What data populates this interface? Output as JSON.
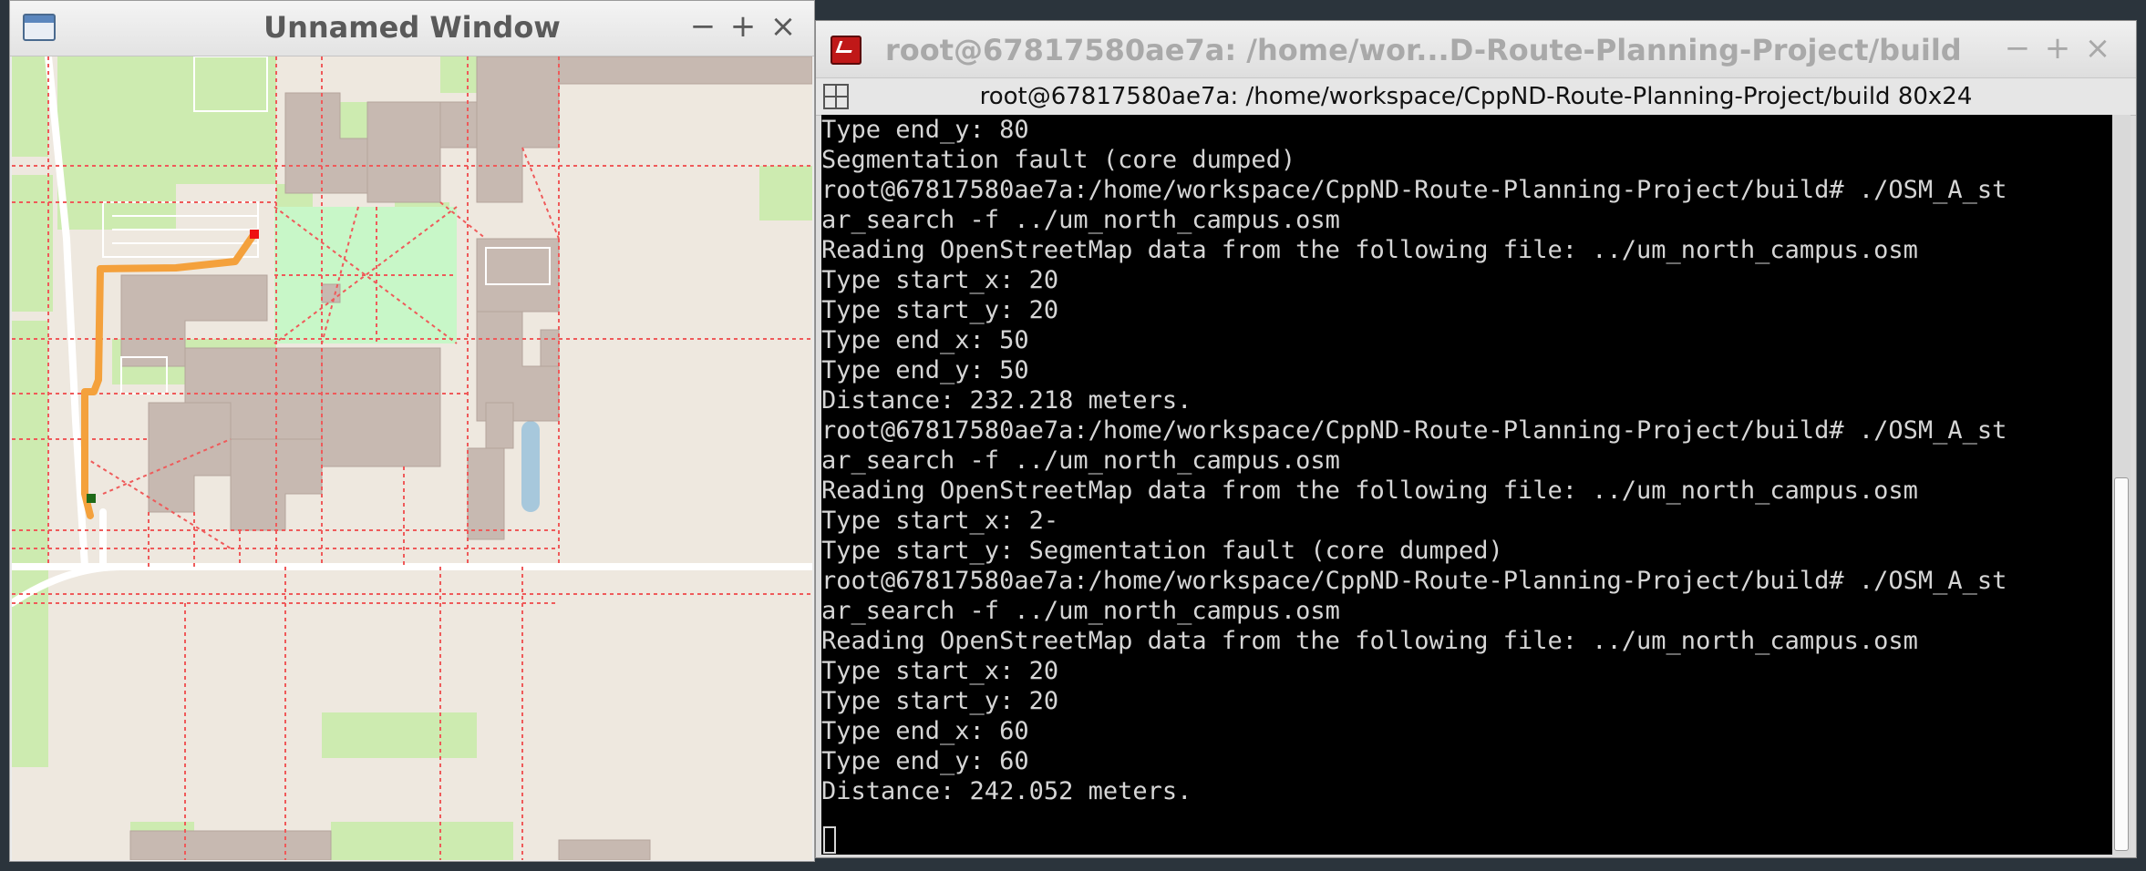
{
  "map_window": {
    "title": "Unnamed Window",
    "controls": {
      "minimize": "−",
      "maximize": "+",
      "close": "×"
    }
  },
  "terminal_window": {
    "title": "root@67817580ae7a: /home/wor...D-Route-Planning-Project/build",
    "subtitle": "root@67817580ae7a: /home/workspace/CppND-Route-Planning-Project/build 80x24",
    "controls": {
      "minimize": "−",
      "maximize": "+",
      "close": "×"
    },
    "lines": [
      "Type end_y: 80",
      "Segmentation fault (core dumped)",
      "root@67817580ae7a:/home/workspace/CppND-Route-Planning-Project/build# ./OSM_A_st",
      "ar_search -f ../um_north_campus.osm",
      "Reading OpenStreetMap data from the following file: ../um_north_campus.osm",
      "Type start_x: 20",
      "Type start_y: 20",
      "Type end_x: 50",
      "Type end_y: 50",
      "Distance: 232.218 meters.",
      "root@67817580ae7a:/home/workspace/CppND-Route-Planning-Project/build# ./OSM_A_st",
      "ar_search -f ../um_north_campus.osm",
      "Reading OpenStreetMap data from the following file: ../um_north_campus.osm",
      "Type start_x: 2-",
      "Type start_y: Segmentation fault (core dumped)",
      "root@67817580ae7a:/home/workspace/CppND-Route-Planning-Project/build# ./OSM_A_st",
      "ar_search -f ../um_north_campus.osm",
      "Reading OpenStreetMap data from the following file: ../um_north_campus.osm",
      "Type start_x: 20",
      "Type start_y: 20",
      "Type end_x: 60",
      "Type end_y: 60",
      "Distance: 242.052 meters."
    ]
  },
  "colors": {
    "route": "#f4a13c",
    "start_marker": "#1f6a18",
    "end_marker": "#ee1111",
    "building": "#c7b9b1",
    "park": "#c8f0c8",
    "grass": "#cdebb0",
    "water": "#a7c8dc",
    "footway": "#ef5a5a"
  }
}
